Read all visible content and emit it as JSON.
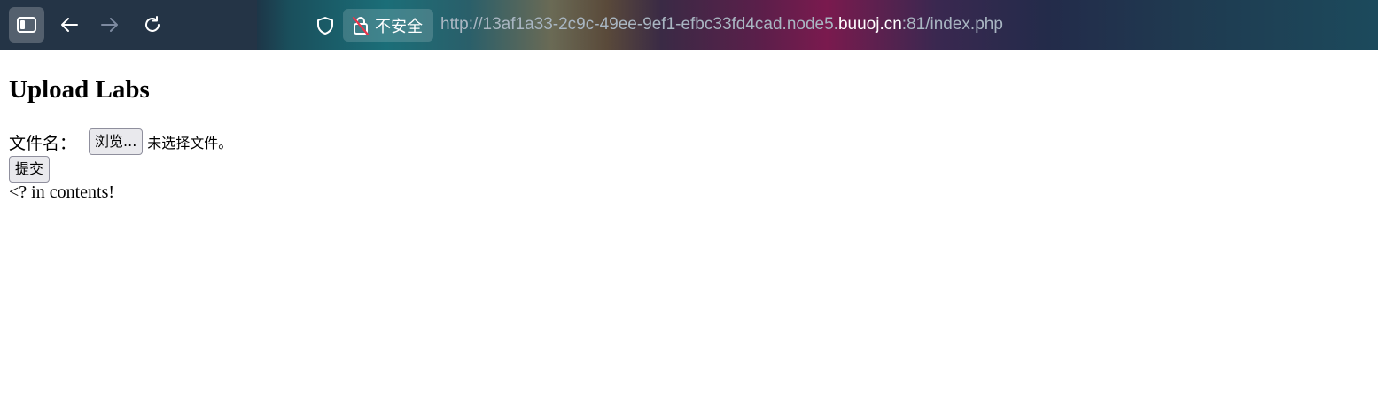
{
  "browser": {
    "security_label": "不安全",
    "url_prefix": "http://13af1a33-2c9c-49ee-9ef1-efbc33fd4cad.node5.",
    "url_host": "buuoj.cn",
    "url_suffix": ":81/index.php"
  },
  "page": {
    "title": "Upload Labs",
    "file_label": "文件名：",
    "browse_button": "浏览...",
    "no_file_text": "未选择文件。",
    "submit_button": "提交",
    "message": "<? in contents!"
  }
}
